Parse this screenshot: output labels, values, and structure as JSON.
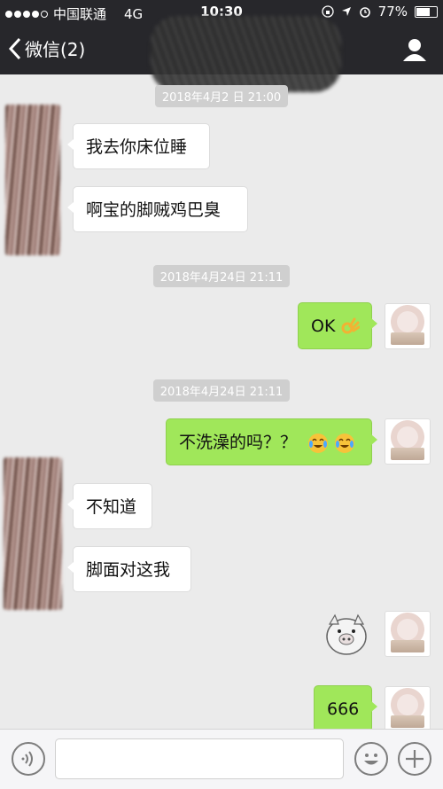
{
  "status_bar": {
    "carrier": "中国联通",
    "network": "4G",
    "time": "10:30",
    "battery": "77%",
    "battery_level": 0.77
  },
  "nav": {
    "back_label": "微信(2)"
  },
  "timestamps": [
    "2018年4月24日 21:11",
    "2018年4月24日 21:11"
  ],
  "messages": [
    {
      "side": "in",
      "text": "我去你床位睡"
    },
    {
      "side": "in",
      "text": "啊宝的脚贼鸡巴臭"
    },
    {
      "side": "out",
      "text": "OK"
    },
    {
      "side": "out",
      "text": "不洗澡的吗？？"
    },
    {
      "side": "in",
      "text": "不知道"
    },
    {
      "side": "in",
      "text": "脚面对这我"
    },
    {
      "side": "out",
      "text": "666"
    }
  ],
  "icons": [
    "signal-dots",
    "lock-rotation-icon",
    "location-arrow-icon",
    "alarm-icon",
    "battery-icon",
    "back-chevron-icon",
    "user-icon",
    "ok-hand-emoji",
    "laughing-crying-emoji",
    "voice-icon",
    "emoji-icon",
    "plus-icon",
    "pig-sticker"
  ]
}
